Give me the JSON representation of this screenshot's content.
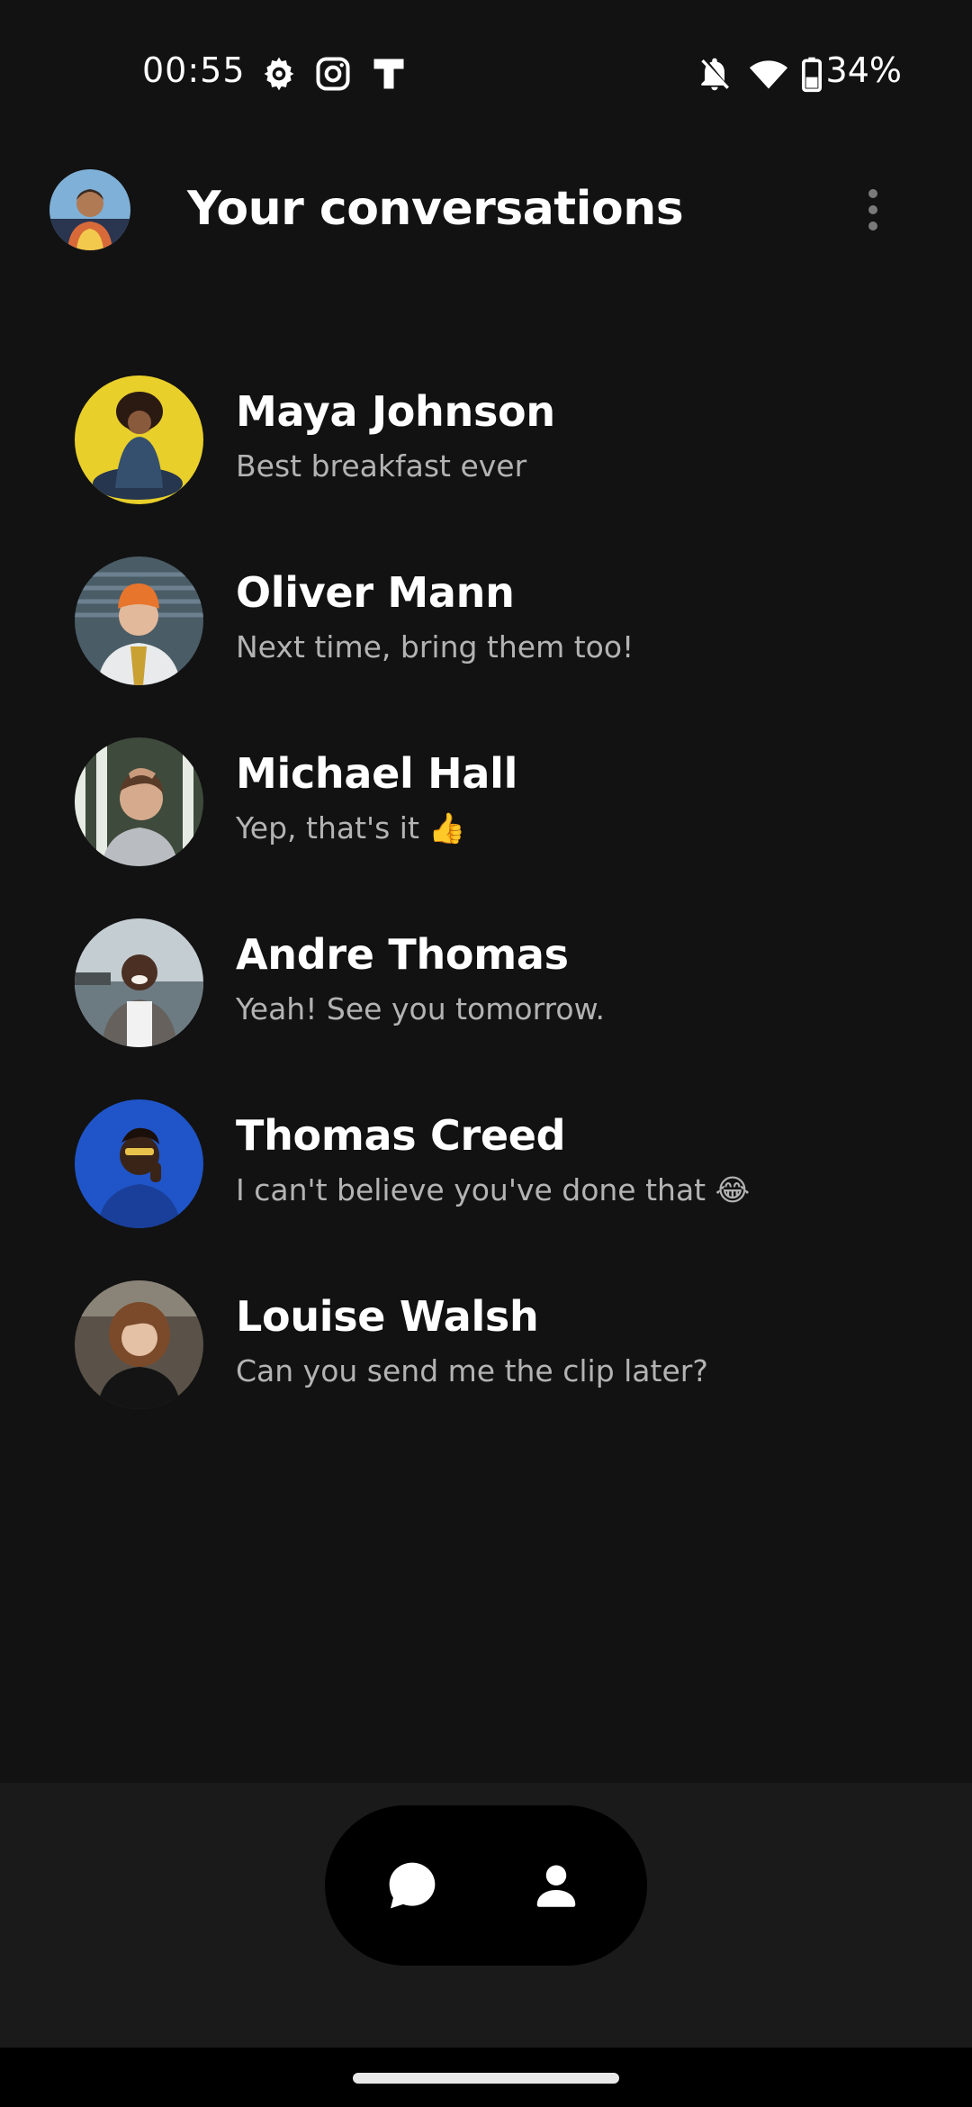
{
  "status_bar": {
    "time": "00:55",
    "icons": [
      "settings-gear-icon",
      "instagram-icon",
      "t-app-icon"
    ],
    "right_icons": [
      "notifications-off-icon",
      "wifi-icon",
      "battery-icon"
    ],
    "battery": "34%"
  },
  "header": {
    "title": "Your conversations",
    "avatar": "profile-avatar",
    "menu_icon": "more-vert-icon"
  },
  "conversations": [
    {
      "name": "Maya Johnson",
      "preview": "Best breakfast ever",
      "avatar_color": "#e9cf2a"
    },
    {
      "name": "Oliver Mann",
      "preview": "Next time, bring them too!",
      "avatar_color": "#5f6f78"
    },
    {
      "name": "Michael Hall",
      "preview": "Yep, that's it 👍",
      "avatar_color": "#6d8a6e"
    },
    {
      "name": "Andre Thomas",
      "preview": "Yeah! See you tomorrow.",
      "avatar_color": "#9aa3a8"
    },
    {
      "name": "Thomas Creed",
      "preview": "I can't believe you've done that 😂",
      "avatar_color": "#1f55c8"
    },
    {
      "name": "Louise Walsh",
      "preview": "Can you send me the clip later?",
      "avatar_color": "#3a3530"
    }
  ],
  "bottom_nav": {
    "items": [
      "chat-bubble-icon",
      "person-icon"
    ]
  },
  "colors": {
    "background": "#121212",
    "text_primary": "#ffffff",
    "text_secondary": "#b3b3b3",
    "nav_pill": "#000000"
  }
}
